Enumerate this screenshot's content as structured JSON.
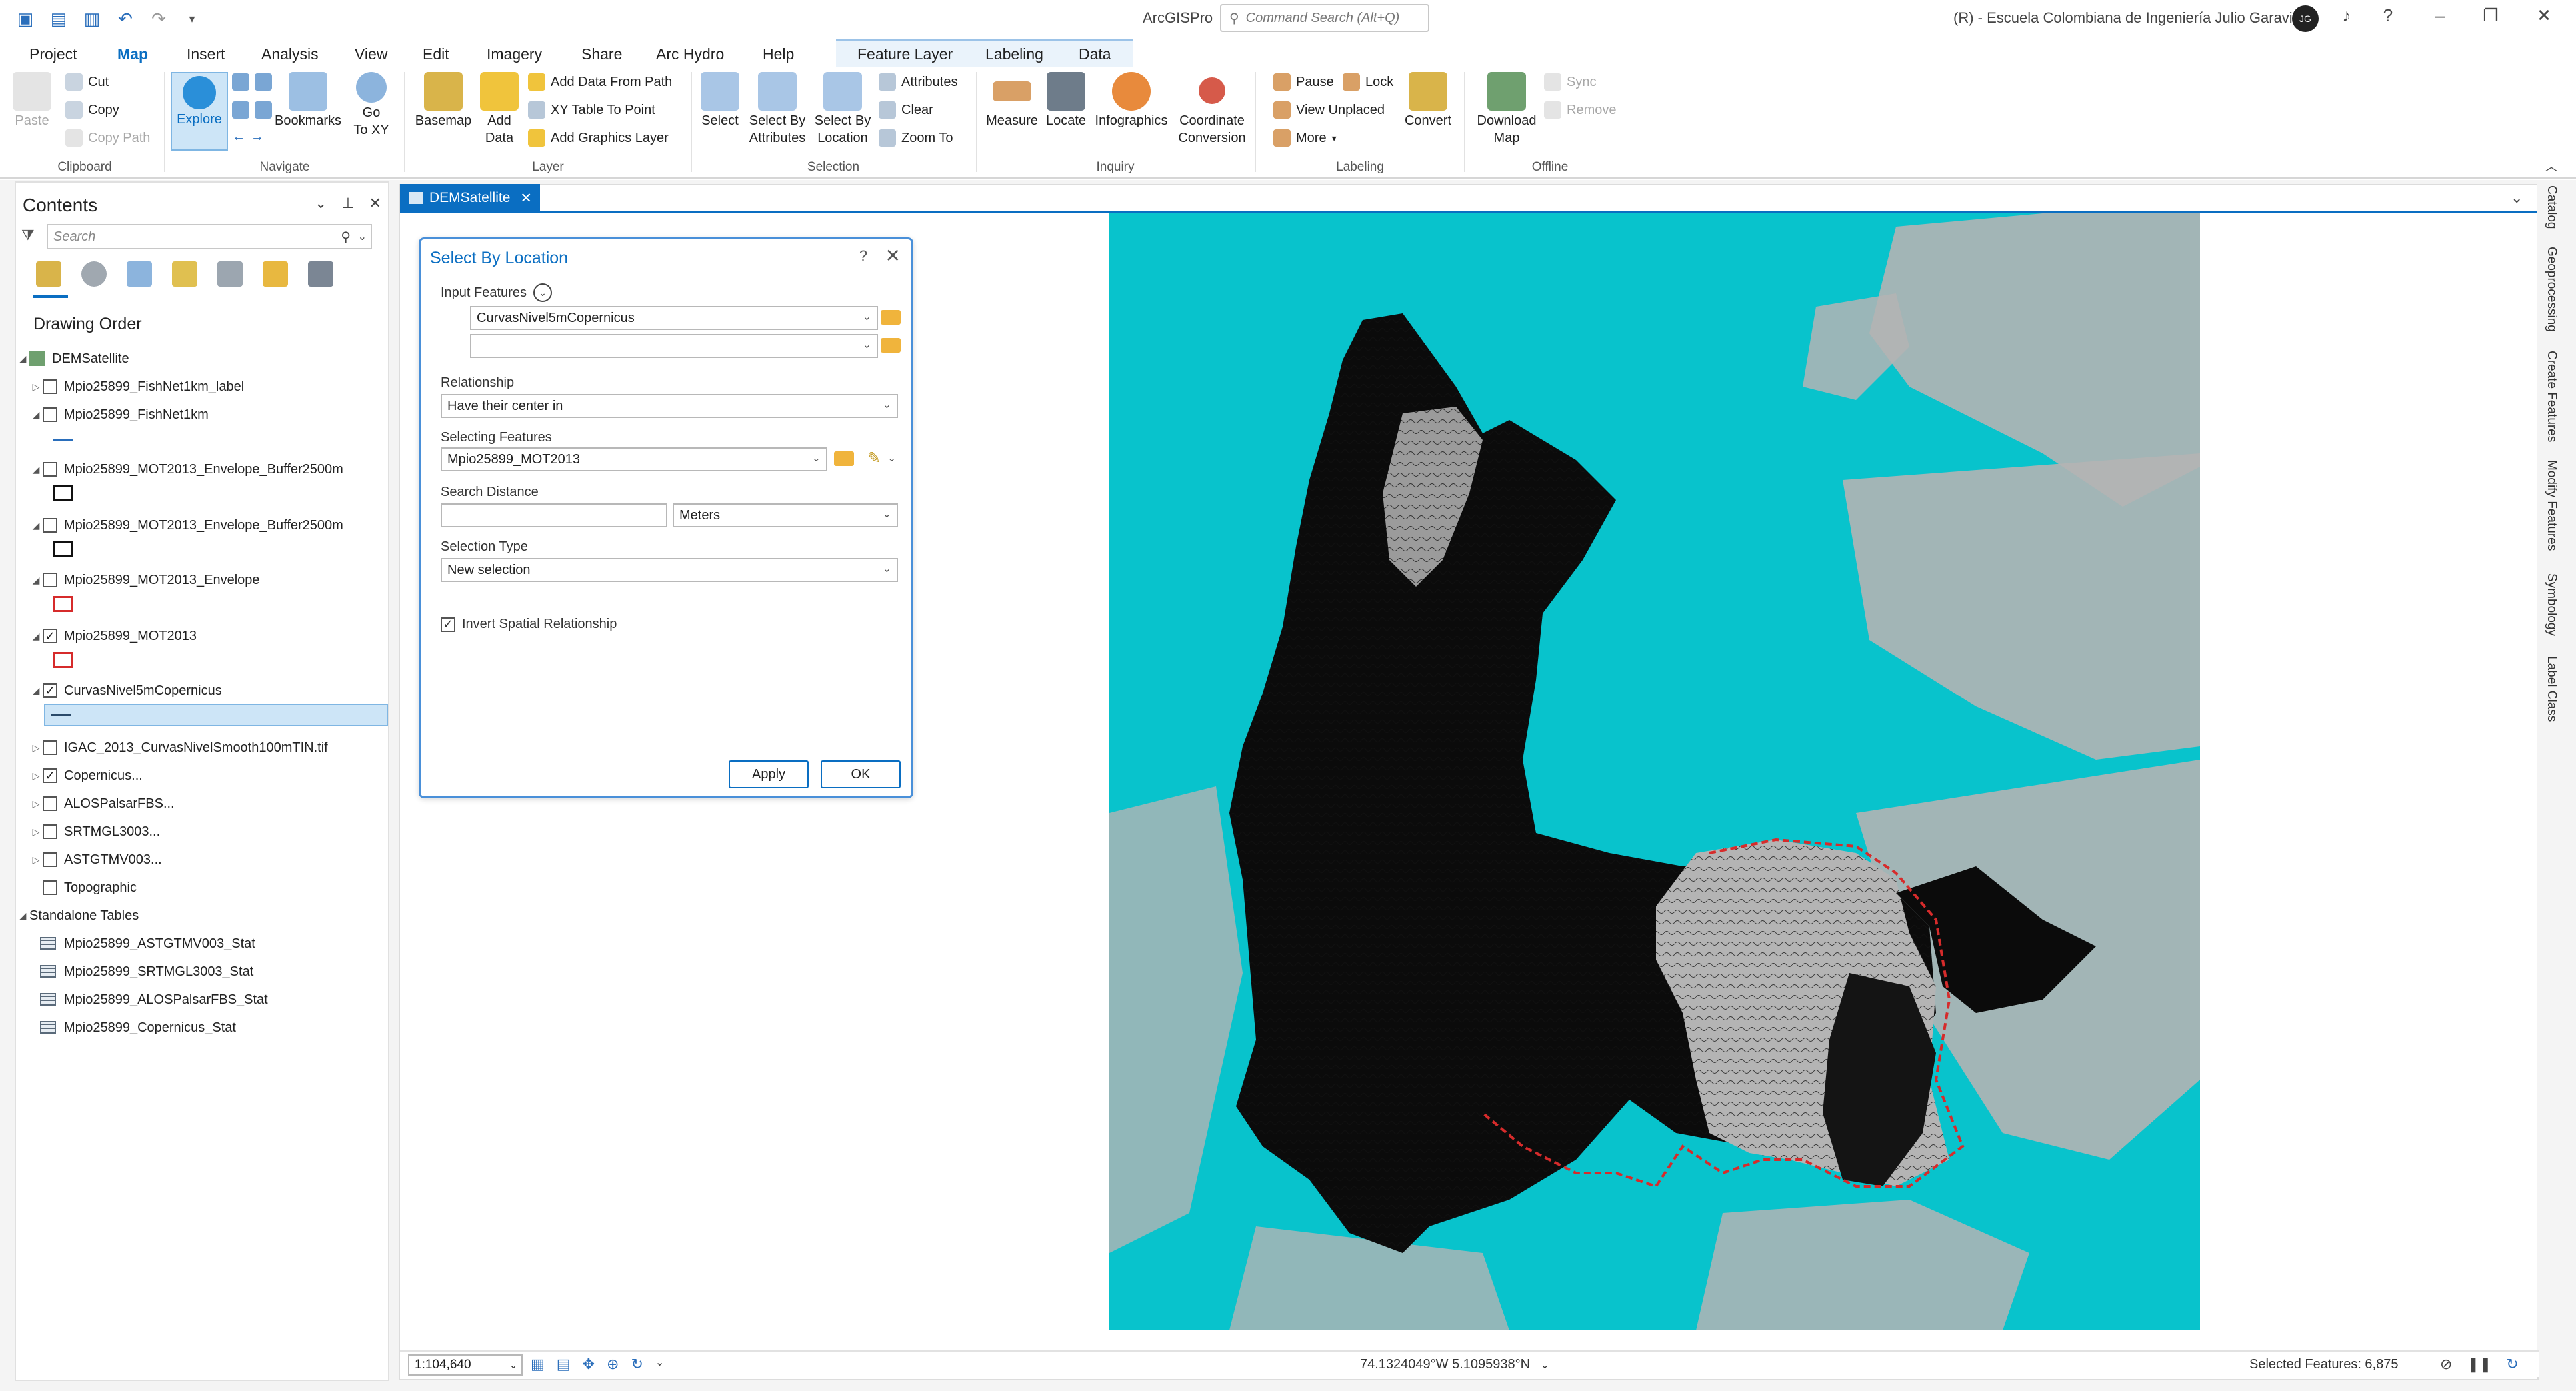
{
  "app": {
    "title": "ArcGISPro",
    "command_search_placeholder": "Command Search (Alt+Q)",
    "organization": "(R) - Escuela Colombiana de Ingeniería Julio Garavito",
    "avatar_initials": "JG",
    "help_glyph": "?"
  },
  "ribbon_tabs": [
    "Project",
    "Map",
    "Insert",
    "Analysis",
    "View",
    "Edit",
    "Imagery",
    "Share",
    "Arc Hydro",
    "Help"
  ],
  "context_tabs": [
    "Feature Layer",
    "Labeling",
    "Data"
  ],
  "ribbon": {
    "clipboard": {
      "label": "Clipboard",
      "paste": "Paste",
      "cut": "Cut",
      "copy": "Copy",
      "copy_path": "Copy Path"
    },
    "navigate": {
      "label": "Navigate",
      "explore": "Explore",
      "bookmarks": "Bookmarks",
      "go_to": "Go",
      "go_to2": "To XY"
    },
    "layer": {
      "label": "Layer",
      "basemap": "Basemap",
      "add_data": "Add",
      "add_data2": "Data",
      "add_from_path": "Add Data From Path",
      "xy_table": "XY Table To Point",
      "add_graphics": "Add Graphics Layer"
    },
    "selection": {
      "label": "Selection",
      "select": "Select",
      "by_attr": "Select By",
      "by_attr2": "Attributes",
      "by_loc": "Select By",
      "by_loc2": "Location",
      "attributes": "Attributes",
      "clear": "Clear",
      "zoom_to": "Zoom To"
    },
    "inquiry": {
      "label": "Inquiry",
      "measure": "Measure",
      "locate": "Locate",
      "infographics": "Infographics",
      "coord": "Coordinate",
      "coord2": "Conversion"
    },
    "labeling": {
      "label": "Labeling",
      "pause": "Pause",
      "lock": "Lock",
      "view_unplaced": "View Unplaced",
      "more": "More",
      "convert": "Convert"
    },
    "offline": {
      "label": "Offline",
      "download": "Download",
      "download2": "Map",
      "sync": "Sync",
      "remove": "Remove"
    }
  },
  "contents": {
    "title": "Contents",
    "search_placeholder": "Search",
    "drawing_order": "Drawing Order",
    "map_name": "DEMSatellite",
    "layers": [
      {
        "name": "Mpio25899_FishNet1km_label",
        "checked": false,
        "expanded": false
      },
      {
        "name": "Mpio25899_FishNet1km",
        "checked": false,
        "expanded": true
      },
      {
        "name": "Mpio25899_MOT2013_Envelope_Buffer2500m",
        "checked": false,
        "expanded": true
      },
      {
        "name": "Mpio25899_MOT2013_Envelope_Buffer2500m",
        "checked": false,
        "expanded": true
      },
      {
        "name": "Mpio25899_MOT2013_Envelope",
        "checked": false,
        "expanded": true
      },
      {
        "name": "Mpio25899_MOT2013",
        "checked": true,
        "expanded": true
      },
      {
        "name": "CurvasNivel5mCopernicus",
        "checked": true,
        "expanded": true
      },
      {
        "name": "IGAC_2013_CurvasNivelSmooth100mTIN.tif",
        "checked": false,
        "expanded": false
      },
      {
        "name": "Copernicus...",
        "checked": true,
        "expanded": false
      },
      {
        "name": "ALOSPalsarFBS...",
        "checked": false,
        "expanded": false
      },
      {
        "name": "SRTMGL3003...",
        "checked": false,
        "expanded": false
      },
      {
        "name": "ASTGTMV003...",
        "checked": false,
        "expanded": false
      },
      {
        "name": "Topographic",
        "checked": false,
        "expanded": false
      }
    ],
    "standalone_label": "Standalone Tables",
    "tables": [
      "Mpio25899_ASTGTMV003_Stat",
      "Mpio25899_SRTMGL3003_Stat",
      "Mpio25899_ALOSPalsarFBS_Stat",
      "Mpio25899_Copernicus_Stat"
    ]
  },
  "map_tab": "DEMSatellite",
  "dialog": {
    "title": "Select By Location",
    "input_features_label": "Input Features",
    "input_feature_1": "CurvasNivel5mCopernicus",
    "input_feature_2": "",
    "relationship_label": "Relationship",
    "relationship_value": "Have their center in",
    "selecting_label": "Selecting Features",
    "selecting_value": "Mpio25899_MOT2013",
    "distance_label": "Search Distance",
    "distance_value": "",
    "distance_unit": "Meters",
    "selection_type_label": "Selection Type",
    "selection_type_value": "New selection",
    "invert_label": "Invert Spatial Relationship",
    "invert_checked": true,
    "apply": "Apply",
    "ok": "OK"
  },
  "right_rail": [
    "Catalog",
    "Geoprocessing",
    "Create Features",
    "Modify Features",
    "Symbology",
    "Label Class"
  ],
  "status": {
    "scale": "1:104,640",
    "coordinates": "74.1324049°W 5.1095938°N",
    "selected": "Selected Features: 6,875"
  },
  "colors": {
    "accent": "#0a6ec2",
    "map_water": "#08c3cc",
    "map_land": "#b4b4b4",
    "selection_red": "#d62b2b"
  }
}
